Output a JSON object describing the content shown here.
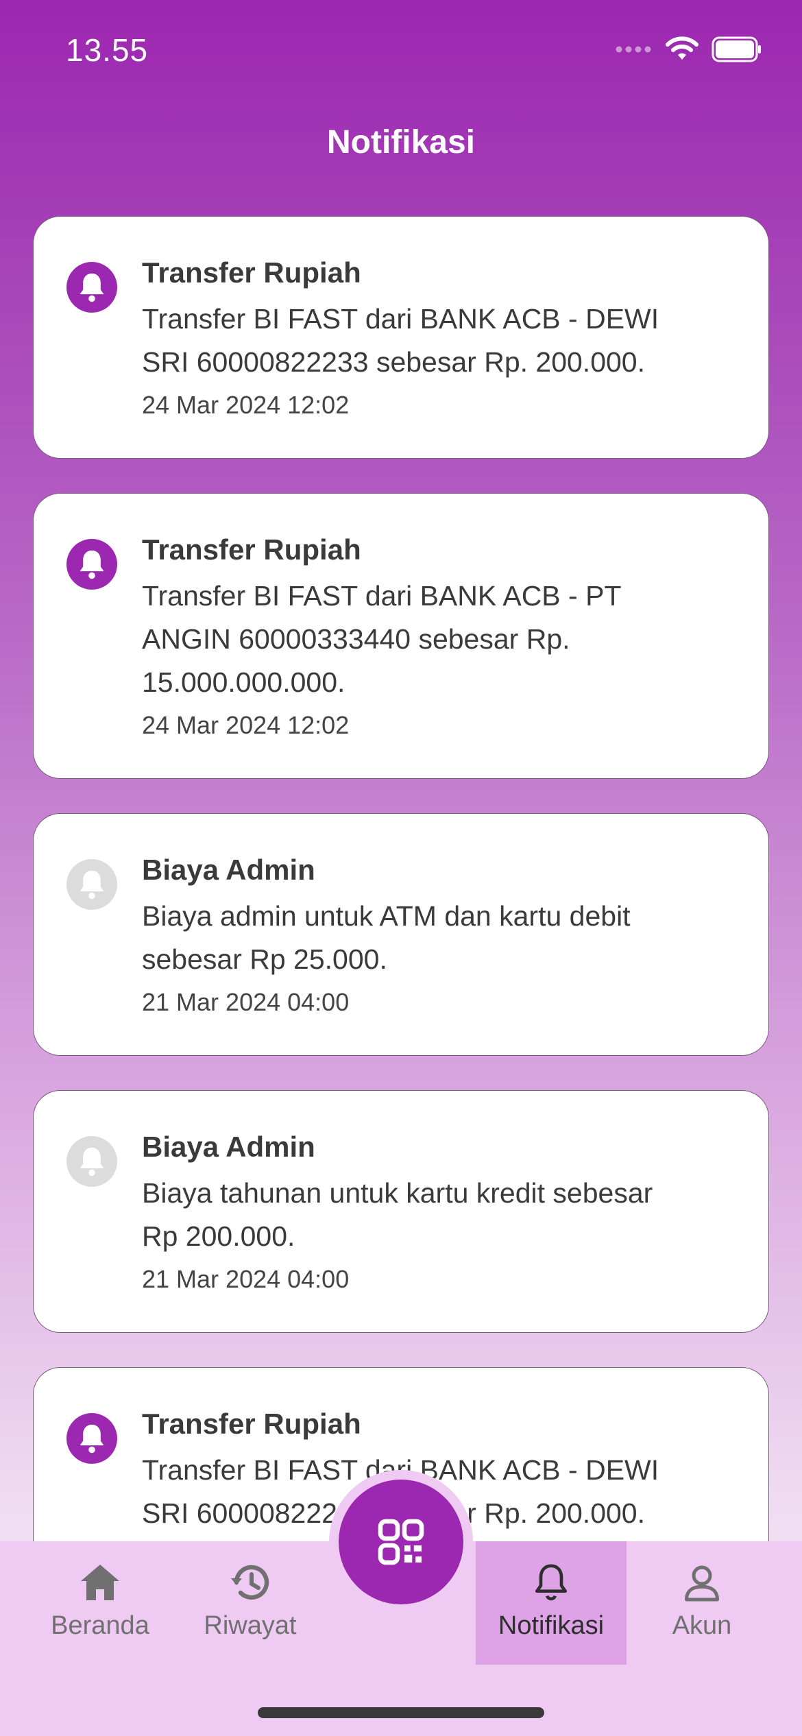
{
  "status_bar": {
    "time": "13.55",
    "icons": [
      "signal-icon",
      "wifi-icon",
      "battery-icon"
    ]
  },
  "header": {
    "title": "Notifikasi"
  },
  "notifications": [
    {
      "title": "Transfer Rupiah",
      "lines": [
        "Transfer BI FAST dari BANK ACB - DEWI",
        "SRI 60000822233 sebesar Rp. 200.000."
      ],
      "time": "24 Mar 2024 12:02",
      "unread": true
    },
    {
      "title": "Transfer Rupiah",
      "lines": [
        "Transfer BI FAST dari BANK ACB - PT",
        "ANGIN 60000333440 sebesar Rp.",
        "15.000.000.000."
      ],
      "time": "24 Mar 2024 12:02",
      "unread": true
    },
    {
      "title": "Biaya Admin",
      "lines": [
        "Biaya admin untuk ATM dan kartu debit",
        "sebesar Rp 25.000."
      ],
      "time": "21 Mar 2024 04:00",
      "unread": false
    },
    {
      "title": "Biaya Admin",
      "lines": [
        "Biaya tahunan untuk kartu kredit sebesar",
        "Rp 200.000."
      ],
      "time": "21 Mar 2024 04:00",
      "unread": false
    },
    {
      "title": "Transfer Rupiah",
      "lines": [
        "Transfer BI FAST dari BANK ACB - DEWI",
        "SRI 60000822233 sebesar Rp. 200.000."
      ],
      "time": "",
      "unread": true
    }
  ],
  "bottom_nav": {
    "items": [
      {
        "label": "Beranda",
        "icon": "home-icon"
      },
      {
        "label": "Riwayat",
        "icon": "history-icon"
      },
      {
        "label": "Notifikasi",
        "icon": "bell-icon",
        "active": true
      },
      {
        "label": "Akun",
        "icon": "user-icon"
      }
    ],
    "fab_icon": "qr-code-icon"
  },
  "colors": {
    "primary": "#9c27b0",
    "nav_background": "#efcbf3",
    "nav_active": "#dea3e6",
    "inactive_icon": "#dcdcdc"
  }
}
